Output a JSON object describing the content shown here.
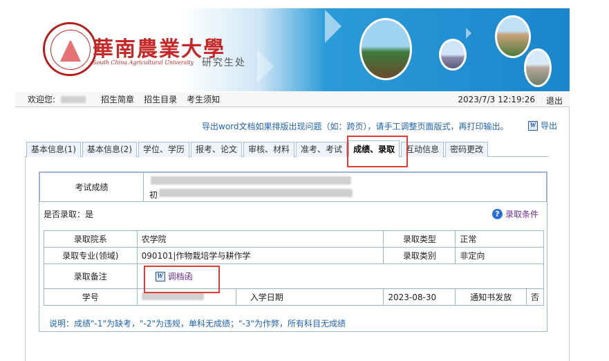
{
  "banner": {
    "school_name": "華南農業大學",
    "school_name_en": "South China Agricultural University",
    "department": "研究生处"
  },
  "topbar": {
    "welcome": "欢迎您:",
    "links": [
      "招生简章",
      "招生目录",
      "考生须知"
    ],
    "datetime": "2023/7/3 12:19:26",
    "logout": "退出"
  },
  "export": {
    "notice": "导出word文档如果排版出现问题（如：跨页），请手工调整页面版式，再打印输出。",
    "button": "导出"
  },
  "tabs": [
    {
      "label": "基本信息(1)",
      "active": false
    },
    {
      "label": "基本信息(2)",
      "active": false
    },
    {
      "label": "学位、学历",
      "active": false
    },
    {
      "label": "报考、论文",
      "active": false
    },
    {
      "label": "审核、材料",
      "active": false
    },
    {
      "label": "准考、考试",
      "active": false
    },
    {
      "label": "成绩、录取",
      "active": true
    },
    {
      "label": "互动信息",
      "active": false
    },
    {
      "label": "密码更改",
      "active": false
    }
  ],
  "score": {
    "label": "考试成绩",
    "value_prefix": "初"
  },
  "admission": {
    "admitted_label": "是否录取：",
    "admitted_value": "是",
    "condition_link": "录取条件",
    "rows": {
      "school_label": "录取院系",
      "school_value": "农学院",
      "type_label": "录取类型",
      "type_value": "正常",
      "major_label": "录取专业(领域)",
      "major_value": "090101|作物栽培学与耕作学",
      "category_label": "录取类别",
      "category_value": "非定向",
      "note_label": "录取备注",
      "note_link": "调档函",
      "student_id_label": "学号",
      "enroll_date_label": "入学日期",
      "enroll_date_value": "2023-08-30",
      "notice_label": "通知书发放",
      "notice_value": "否"
    }
  },
  "footnote": "说明：成绩\"-1\"为缺考，\"-2\"为违规，单科无成绩；\"-3\"为作弊，所有科目无成绩"
}
